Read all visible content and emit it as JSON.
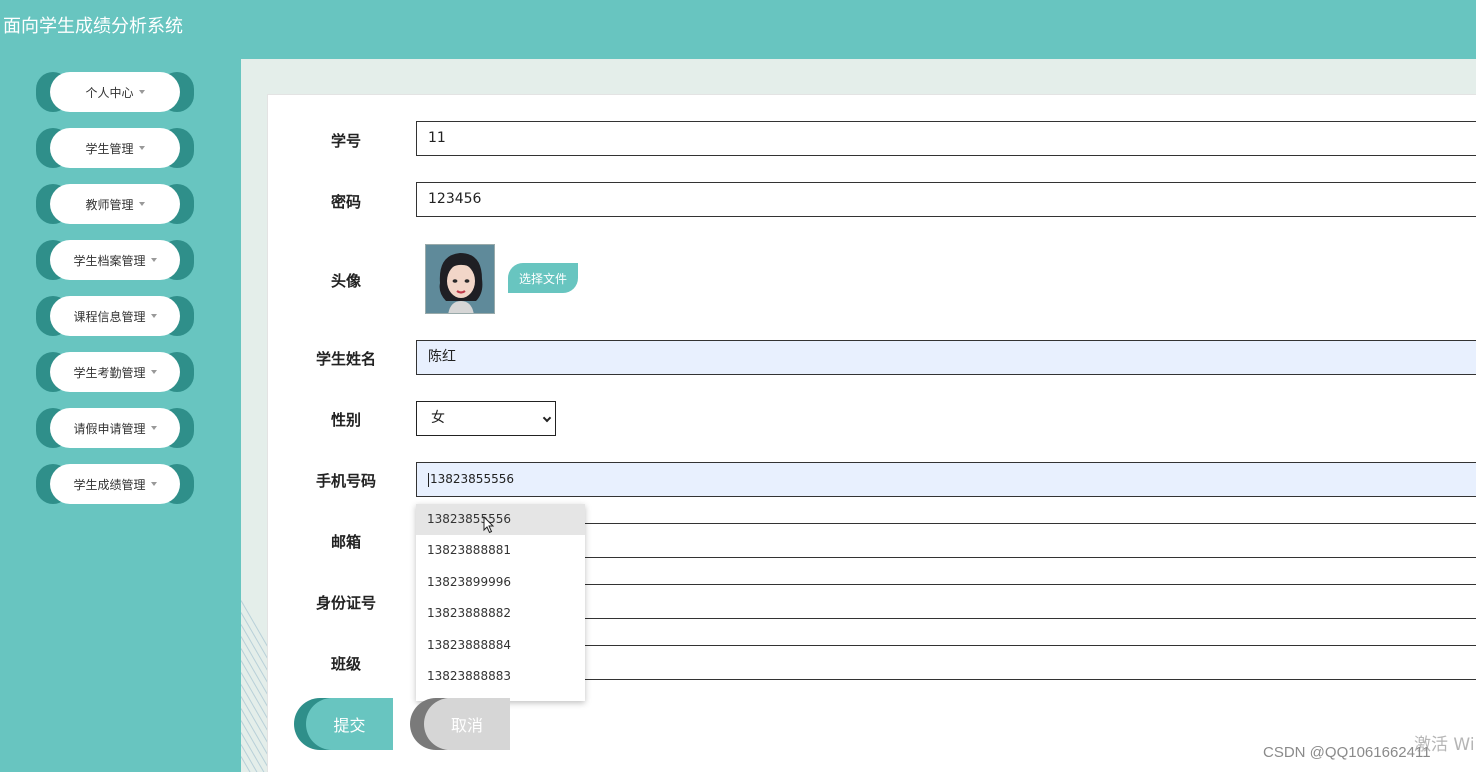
{
  "app": {
    "title": "面向学生成绩分析系统"
  },
  "sidebar": {
    "items": [
      {
        "label": "个人中心"
      },
      {
        "label": "学生管理"
      },
      {
        "label": "教师管理"
      },
      {
        "label": "学生档案管理"
      },
      {
        "label": "课程信息管理"
      },
      {
        "label": "学生考勤管理"
      },
      {
        "label": "请假申请管理"
      },
      {
        "label": "学生成绩管理"
      }
    ]
  },
  "form": {
    "student_no": {
      "label": "学号",
      "value": "11"
    },
    "password": {
      "label": "密码",
      "value": "123456"
    },
    "avatar": {
      "label": "头像",
      "choose_label": "选择文件"
    },
    "name": {
      "label": "学生姓名",
      "value": "陈红"
    },
    "gender": {
      "label": "性别",
      "value": "女"
    },
    "phone": {
      "label": "手机号码",
      "value": "13823855556"
    },
    "email": {
      "label": "邮箱",
      "value": ""
    },
    "id_card": {
      "label": "身份证号",
      "value": ""
    },
    "class": {
      "label": "班级",
      "value": ""
    }
  },
  "autocomplete": {
    "options": [
      "13823855556",
      "13823888881",
      "13823899996",
      "13823888882",
      "13823888884",
      "13823888883"
    ]
  },
  "actions": {
    "submit_label": "提交",
    "cancel_label": "取消"
  },
  "overlay": {
    "watermark": "CSDN @QQ1061662411",
    "activate": "激活 Wi"
  },
  "colors": {
    "accent": "#68c5c0",
    "accent_dark": "#2f8f8a",
    "background": "#e4eeea"
  }
}
